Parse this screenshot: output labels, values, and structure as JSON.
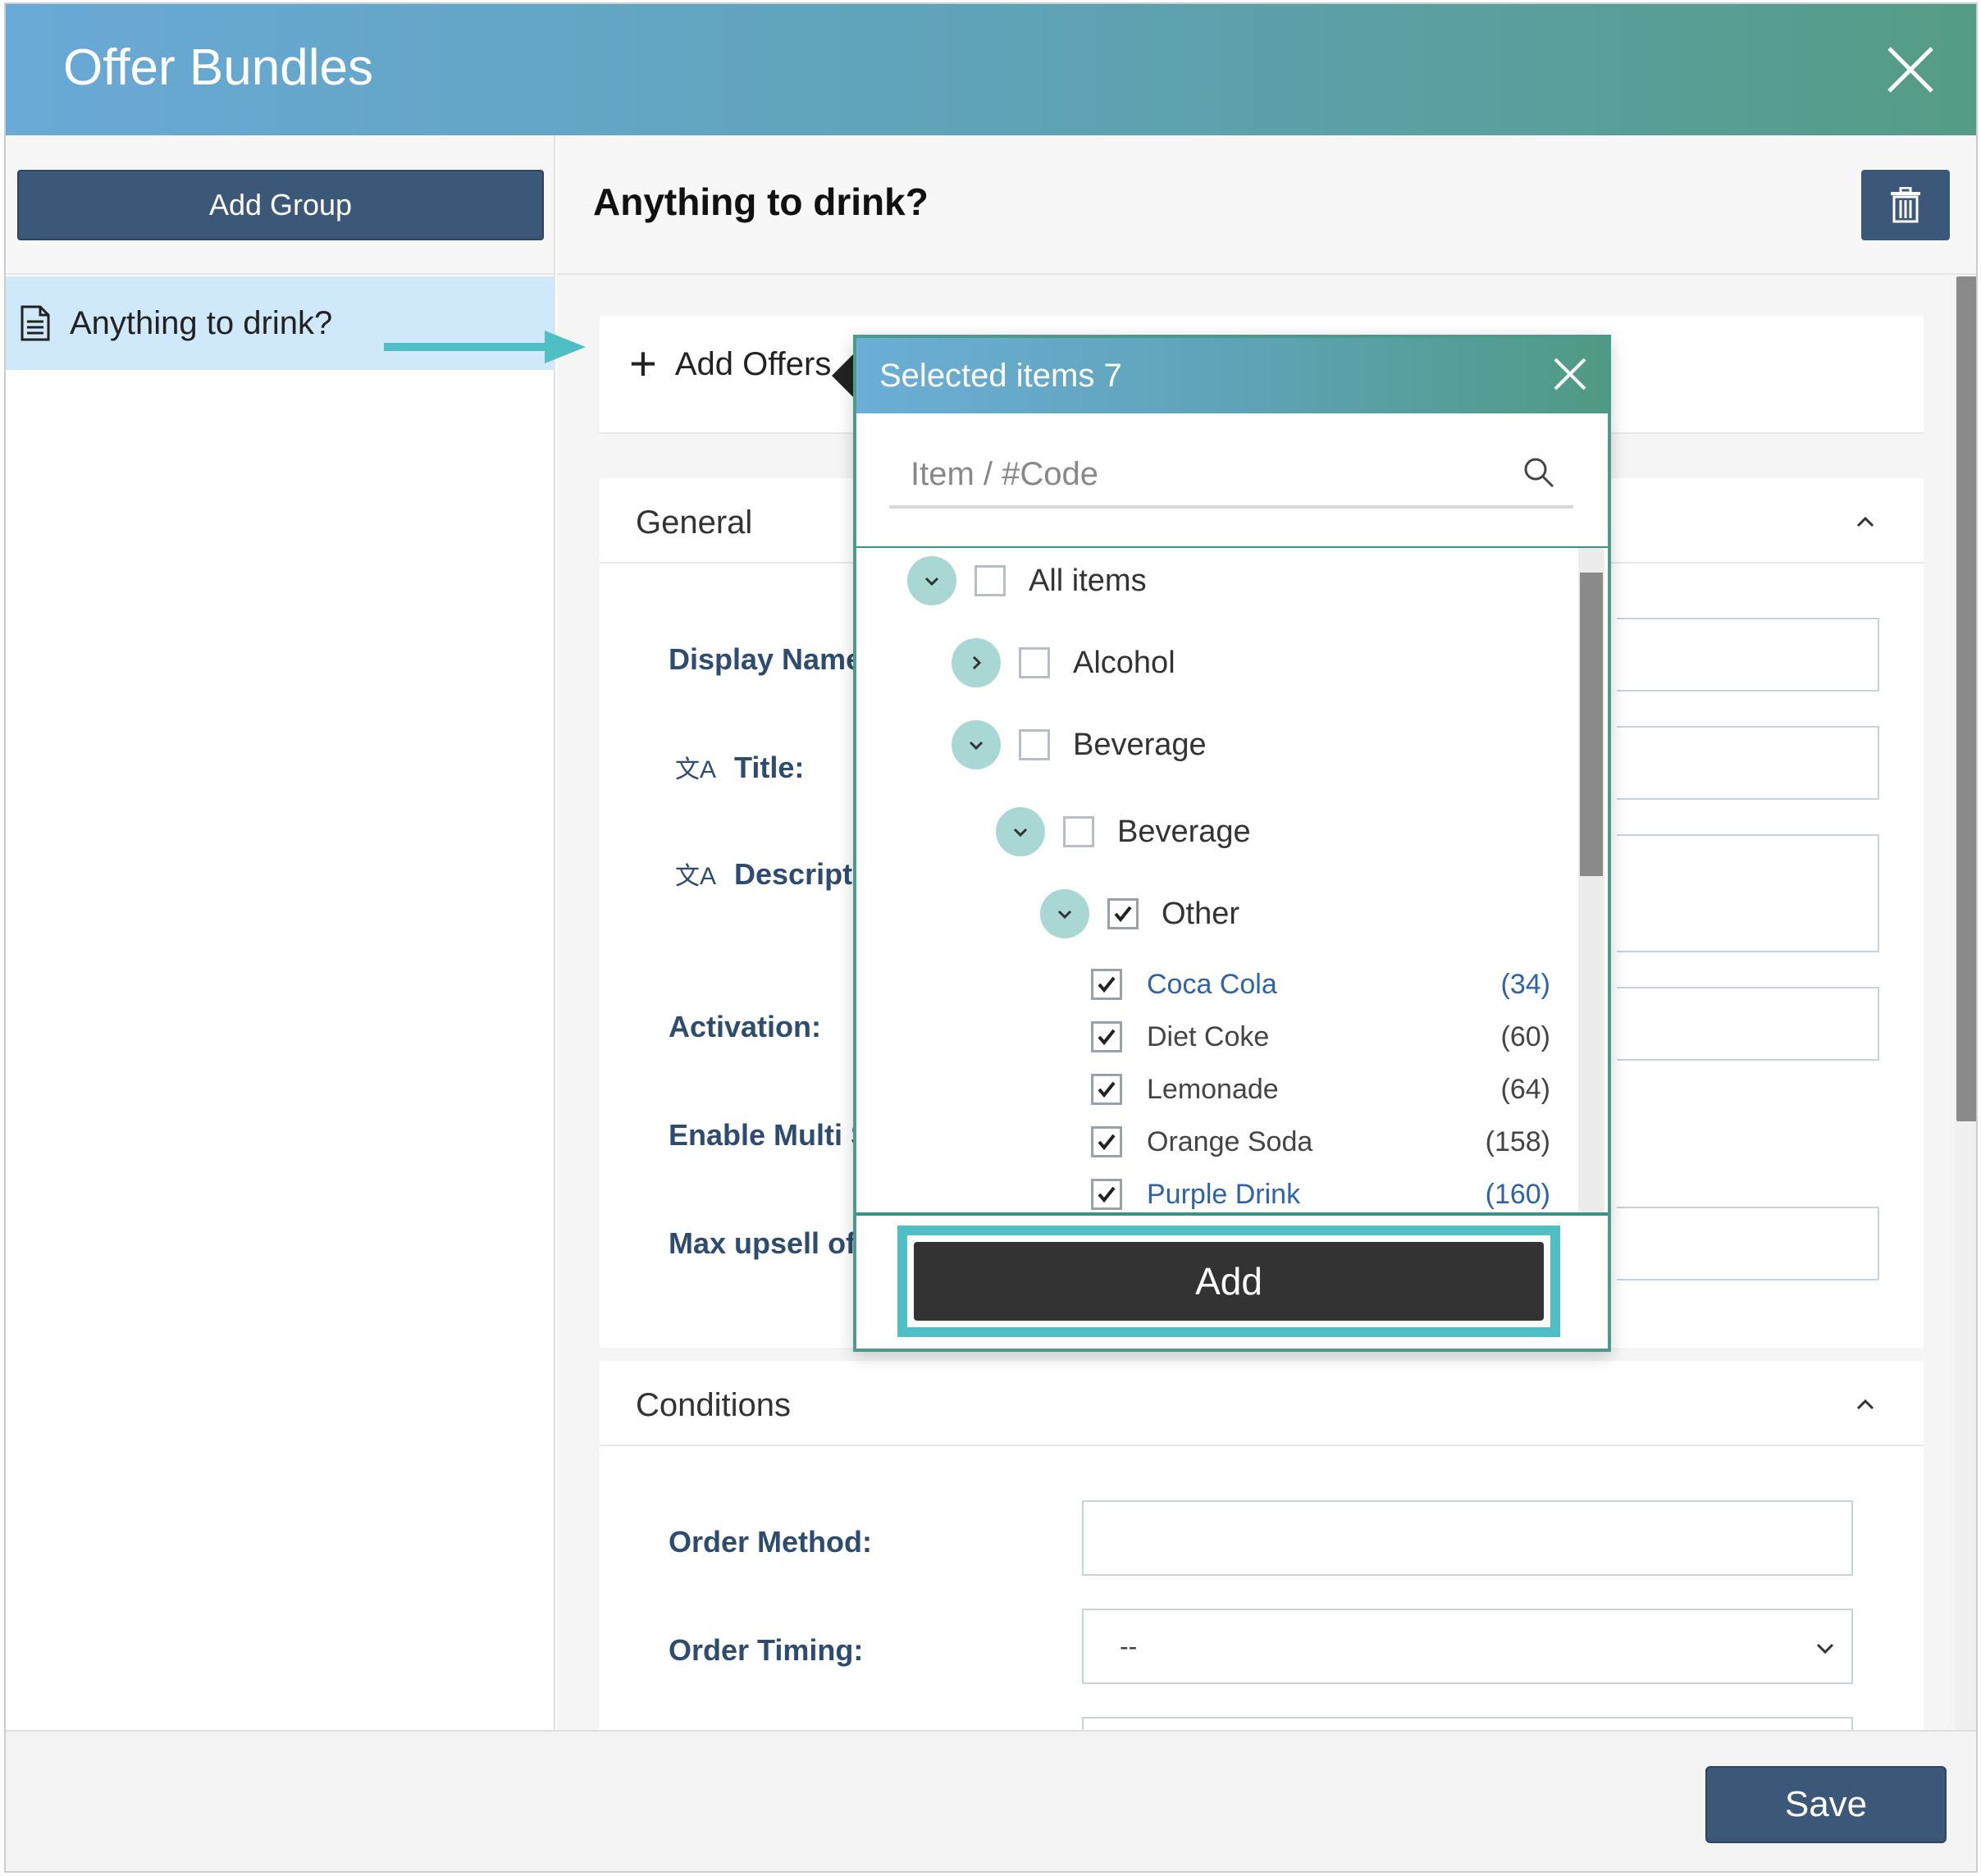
{
  "window": {
    "title": "Offer Bundles",
    "close_icon": "close-icon"
  },
  "sidebar": {
    "add_group_label": "Add Group",
    "items": [
      {
        "label": "Anything to drink?",
        "icon": "document-icon",
        "selected": true
      }
    ]
  },
  "main": {
    "header_title": "Anything to drink?",
    "delete_icon": "trash-icon",
    "add_offers_label": "Add Offers"
  },
  "general": {
    "title": "General",
    "labels": {
      "display_name": "Display Name:",
      "title": "Title:",
      "description": "Descriptio",
      "activation": "Activation:",
      "enable_multi": "Enable Multi Se",
      "max_upsell": "Max upsell offe"
    }
  },
  "conditions": {
    "title": "Conditions",
    "order_method_label": "Order Method:",
    "order_method_value": "",
    "order_timing_label": "Order Timing:",
    "order_timing_value": "--"
  },
  "footer": {
    "save_label": "Save"
  },
  "popup": {
    "title": "Selected items 7",
    "search_placeholder": "Item / #Code",
    "tree": [
      {
        "label": "All items",
        "expanded": true,
        "checked": false
      },
      {
        "label": "Alcohol",
        "expanded": false,
        "checked": false
      },
      {
        "label": "Beverage",
        "expanded": true,
        "checked": false
      },
      {
        "label": "Beverage",
        "expanded": true,
        "checked": false
      },
      {
        "label": "Other",
        "expanded": true,
        "checked": true
      }
    ],
    "items": [
      {
        "name": "Coca Cola",
        "count": "(34)",
        "checked": true,
        "link": true
      },
      {
        "name": "Diet Coke",
        "count": "(60)",
        "checked": true,
        "link": false
      },
      {
        "name": "Lemonade",
        "count": "(64)",
        "checked": true,
        "link": false
      },
      {
        "name": "Orange Soda",
        "count": "(158)",
        "checked": true,
        "link": false
      },
      {
        "name": "Purple Drink",
        "count": "(160)",
        "checked": true,
        "link": true
      }
    ],
    "add_label": "Add"
  },
  "colors": {
    "header_gradient_start": "#69a9d6",
    "header_gradient_end": "#559c86",
    "primary_button": "#3b5878",
    "label_blue": "#2d4c6f",
    "link_blue": "#2f63a8",
    "focus_ring": "#4fbfc5",
    "arrow": "#4fbfc5"
  }
}
